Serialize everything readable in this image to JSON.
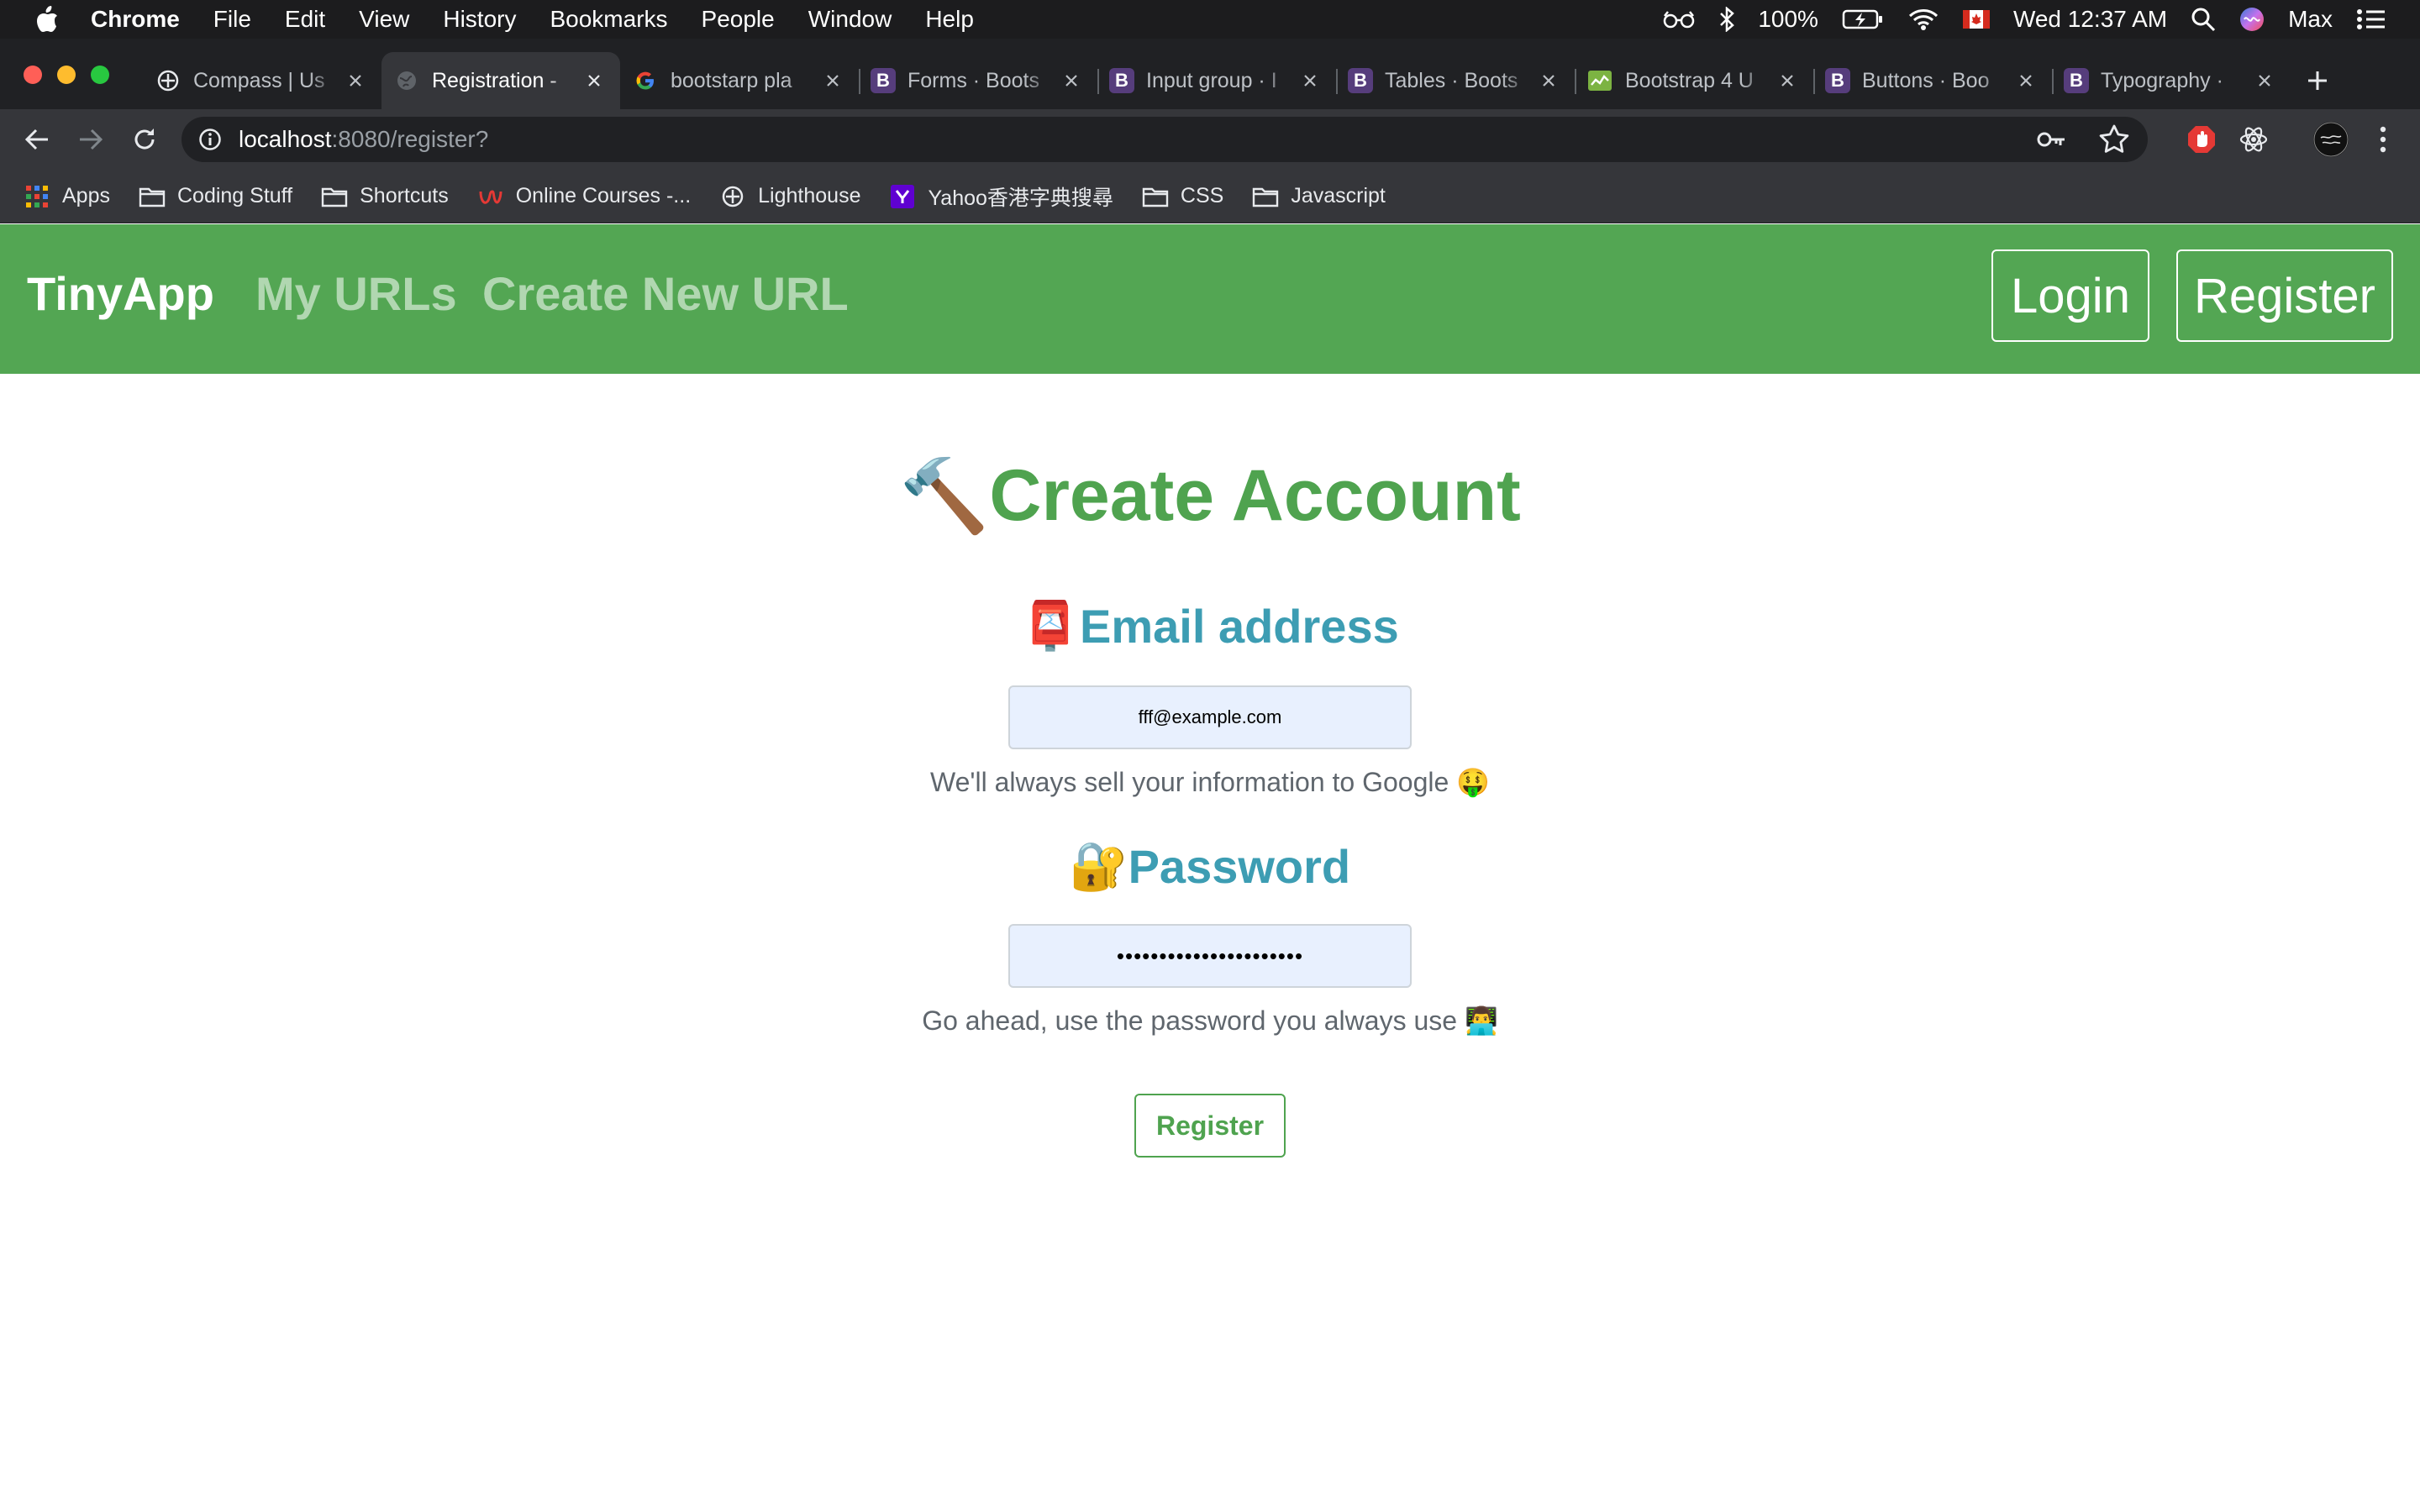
{
  "menubar": {
    "app_name": "Chrome",
    "items": [
      "File",
      "Edit",
      "View",
      "History",
      "Bookmarks",
      "People",
      "Window",
      "Help"
    ],
    "battery": "100%",
    "datetime": "Wed 12:37 AM",
    "user": "Max"
  },
  "tabs": [
    {
      "title": "Compass | Us",
      "favicon": "compass-icon"
    },
    {
      "title": "Registration -",
      "favicon": "globe-icon",
      "active": true
    },
    {
      "title": "bootstarp pla",
      "favicon": "google-icon"
    },
    {
      "title": "Forms · Boots",
      "favicon": "bootstrap-icon"
    },
    {
      "title": "Input group · I",
      "favicon": "bootstrap-icon"
    },
    {
      "title": "Tables · Boots",
      "favicon": "bootstrap-icon"
    },
    {
      "title": "Bootstrap 4 U",
      "favicon": "chart-icon"
    },
    {
      "title": "Buttons · Boo",
      "favicon": "bootstrap-icon"
    },
    {
      "title": "Typography ·",
      "favicon": "bootstrap-icon"
    }
  ],
  "omnibox": {
    "host": "localhost",
    "path": ":8080/register?"
  },
  "bookmarks": [
    {
      "label": "Apps",
      "icon": "apps-grid-icon"
    },
    {
      "label": "Coding Stuff",
      "icon": "folder-icon"
    },
    {
      "label": "Shortcuts",
      "icon": "folder-icon"
    },
    {
      "label": "Online Courses -...",
      "icon": "udemy-icon"
    },
    {
      "label": "Lighthouse",
      "icon": "compass-icon"
    },
    {
      "label": "Yahoo香港字典搜尋",
      "icon": "yahoo-icon"
    },
    {
      "label": "CSS",
      "icon": "folder-icon"
    },
    {
      "label": "Javascript",
      "icon": "folder-icon"
    }
  ],
  "navbar": {
    "brand": "TinyApp",
    "links": [
      "My URLs",
      "Create New URL"
    ],
    "login_label": "Login",
    "register_label": "Register",
    "color": "#53a653"
  },
  "form": {
    "heading": "Create Account",
    "heading_icon": "🔨",
    "email_label": "Email address",
    "email_icon": "📮",
    "email_value": "fff@example.com",
    "email_help": "We'll always sell your information to Google",
    "email_help_icon": "🤑",
    "password_label": "Password",
    "password_icon": "🔐",
    "password_value": "••••••••••••••••••••••",
    "password_help": "Go ahead, use the password you always use",
    "password_help_icon": "👨‍💻",
    "submit_label": "Register"
  }
}
